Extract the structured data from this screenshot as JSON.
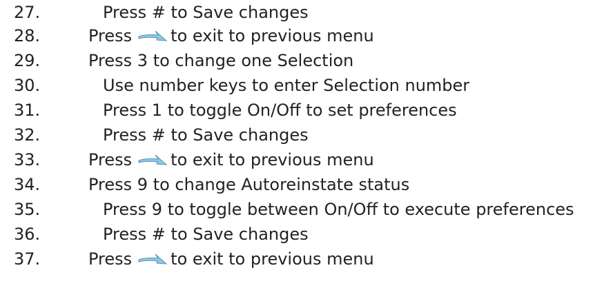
{
  "steps": [
    {
      "number": "27.",
      "text": "Press # to Save changes",
      "indent": 2,
      "icon": null
    },
    {
      "number": "28.",
      "text_before": "Press",
      "text_after": "to exit to previous menu",
      "indent": 1,
      "icon": "back-arrow-icon"
    },
    {
      "number": "29.",
      "text": "Press 3 to change one Selection",
      "indent": 1,
      "icon": null
    },
    {
      "number": "30.",
      "text": "Use number keys to enter Selection number",
      "indent": 2,
      "icon": null
    },
    {
      "number": "31.",
      "text": "Press 1 to toggle On/Off to set preferences",
      "indent": 2,
      "icon": null
    },
    {
      "number": "32.",
      "text": "Press # to Save changes",
      "indent": 2,
      "icon": null
    },
    {
      "number": "33.",
      "text_before": "Press",
      "text_after": "to exit to previous menu",
      "indent": 1,
      "icon": "back-arrow-icon"
    },
    {
      "number": "34.",
      "text": "Press 9 to change Autoreinstate status",
      "indent": 1,
      "icon": null
    },
    {
      "number": "35.",
      "text": "Press 9 to toggle between On/Off to execute preferences",
      "indent": 2,
      "icon": null
    },
    {
      "number": "36.",
      "text": "Press # to Save changes",
      "indent": 2,
      "icon": null
    },
    {
      "number": "37.",
      "text_before": "Press",
      "text_after": "to exit to previous menu",
      "indent": 1,
      "icon": "back-arrow-icon"
    }
  ],
  "colors": {
    "text": "#222222",
    "icon_fill": "#8cc9e8",
    "icon_shadow": "#5e8fa8"
  }
}
